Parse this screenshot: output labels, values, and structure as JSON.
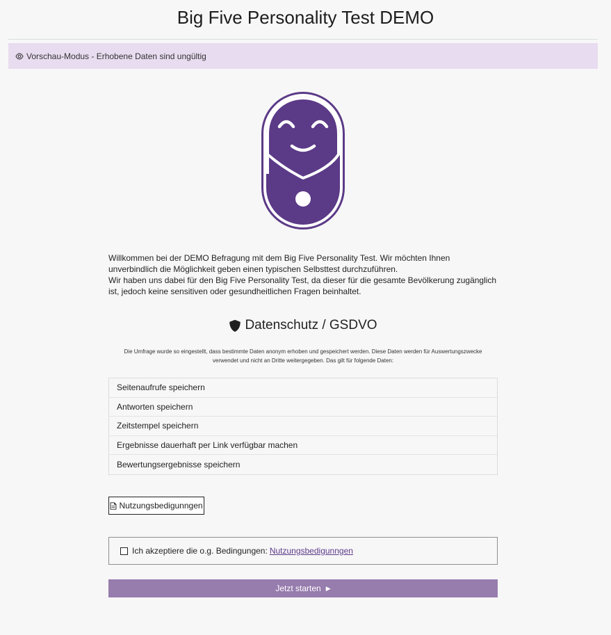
{
  "page": {
    "title": "Big Five Personality Test DEMO"
  },
  "preview_bar": {
    "icon": "eye-icon",
    "text": "Vorschau-Modus - Erhobene Daten sind ungültig"
  },
  "intro": {
    "p1": "Willkommen bei der DEMO Befragung mit dem Big Five Personality Test. Wir möchten Ihnen unverbindlich die Möglichkeit geben einen typischen Selbsttest durchzuführen.",
    "p2": "Wir haben uns dabei für den Big Five Personality Test, da dieser für die gesamte Bevölkerung zugänglich ist, jedoch keine sensitiven oder gesundheitlichen Fragen beinhaltet."
  },
  "privacy": {
    "icon": "shield-icon",
    "heading": "Datenschutz / GSDVO",
    "text": "Die Umfrage wurde so eingestellt, dass bestimmte Daten anonym erhoben und gespeichert werden. Diese Daten werden für Auswertungszwecke verwendet und nicht an Dritte weitergegeben. Das gilt für folgende Daten:",
    "items": [
      "Seitenaufrufe speichern",
      "Antworten speichern",
      "Zeitstempel speichern",
      "Ergebnisse dauerhaft per Link verfügbar machen",
      "Bewertungsergebnisse speichern"
    ]
  },
  "terms_button": {
    "icon": "document-icon",
    "label": "Nutzungsbedigunngen"
  },
  "accept": {
    "checked": false,
    "label": "Ich akzeptiere die o.g. Bedingungen:",
    "link": "Nutzungsbedigunngen"
  },
  "start_button": {
    "label": "Jetzt starten",
    "icon": "caret-right-icon"
  },
  "colors": {
    "accent": "#5c3a8a",
    "button": "#977cae",
    "preview_bg": "#e8dcf0"
  }
}
